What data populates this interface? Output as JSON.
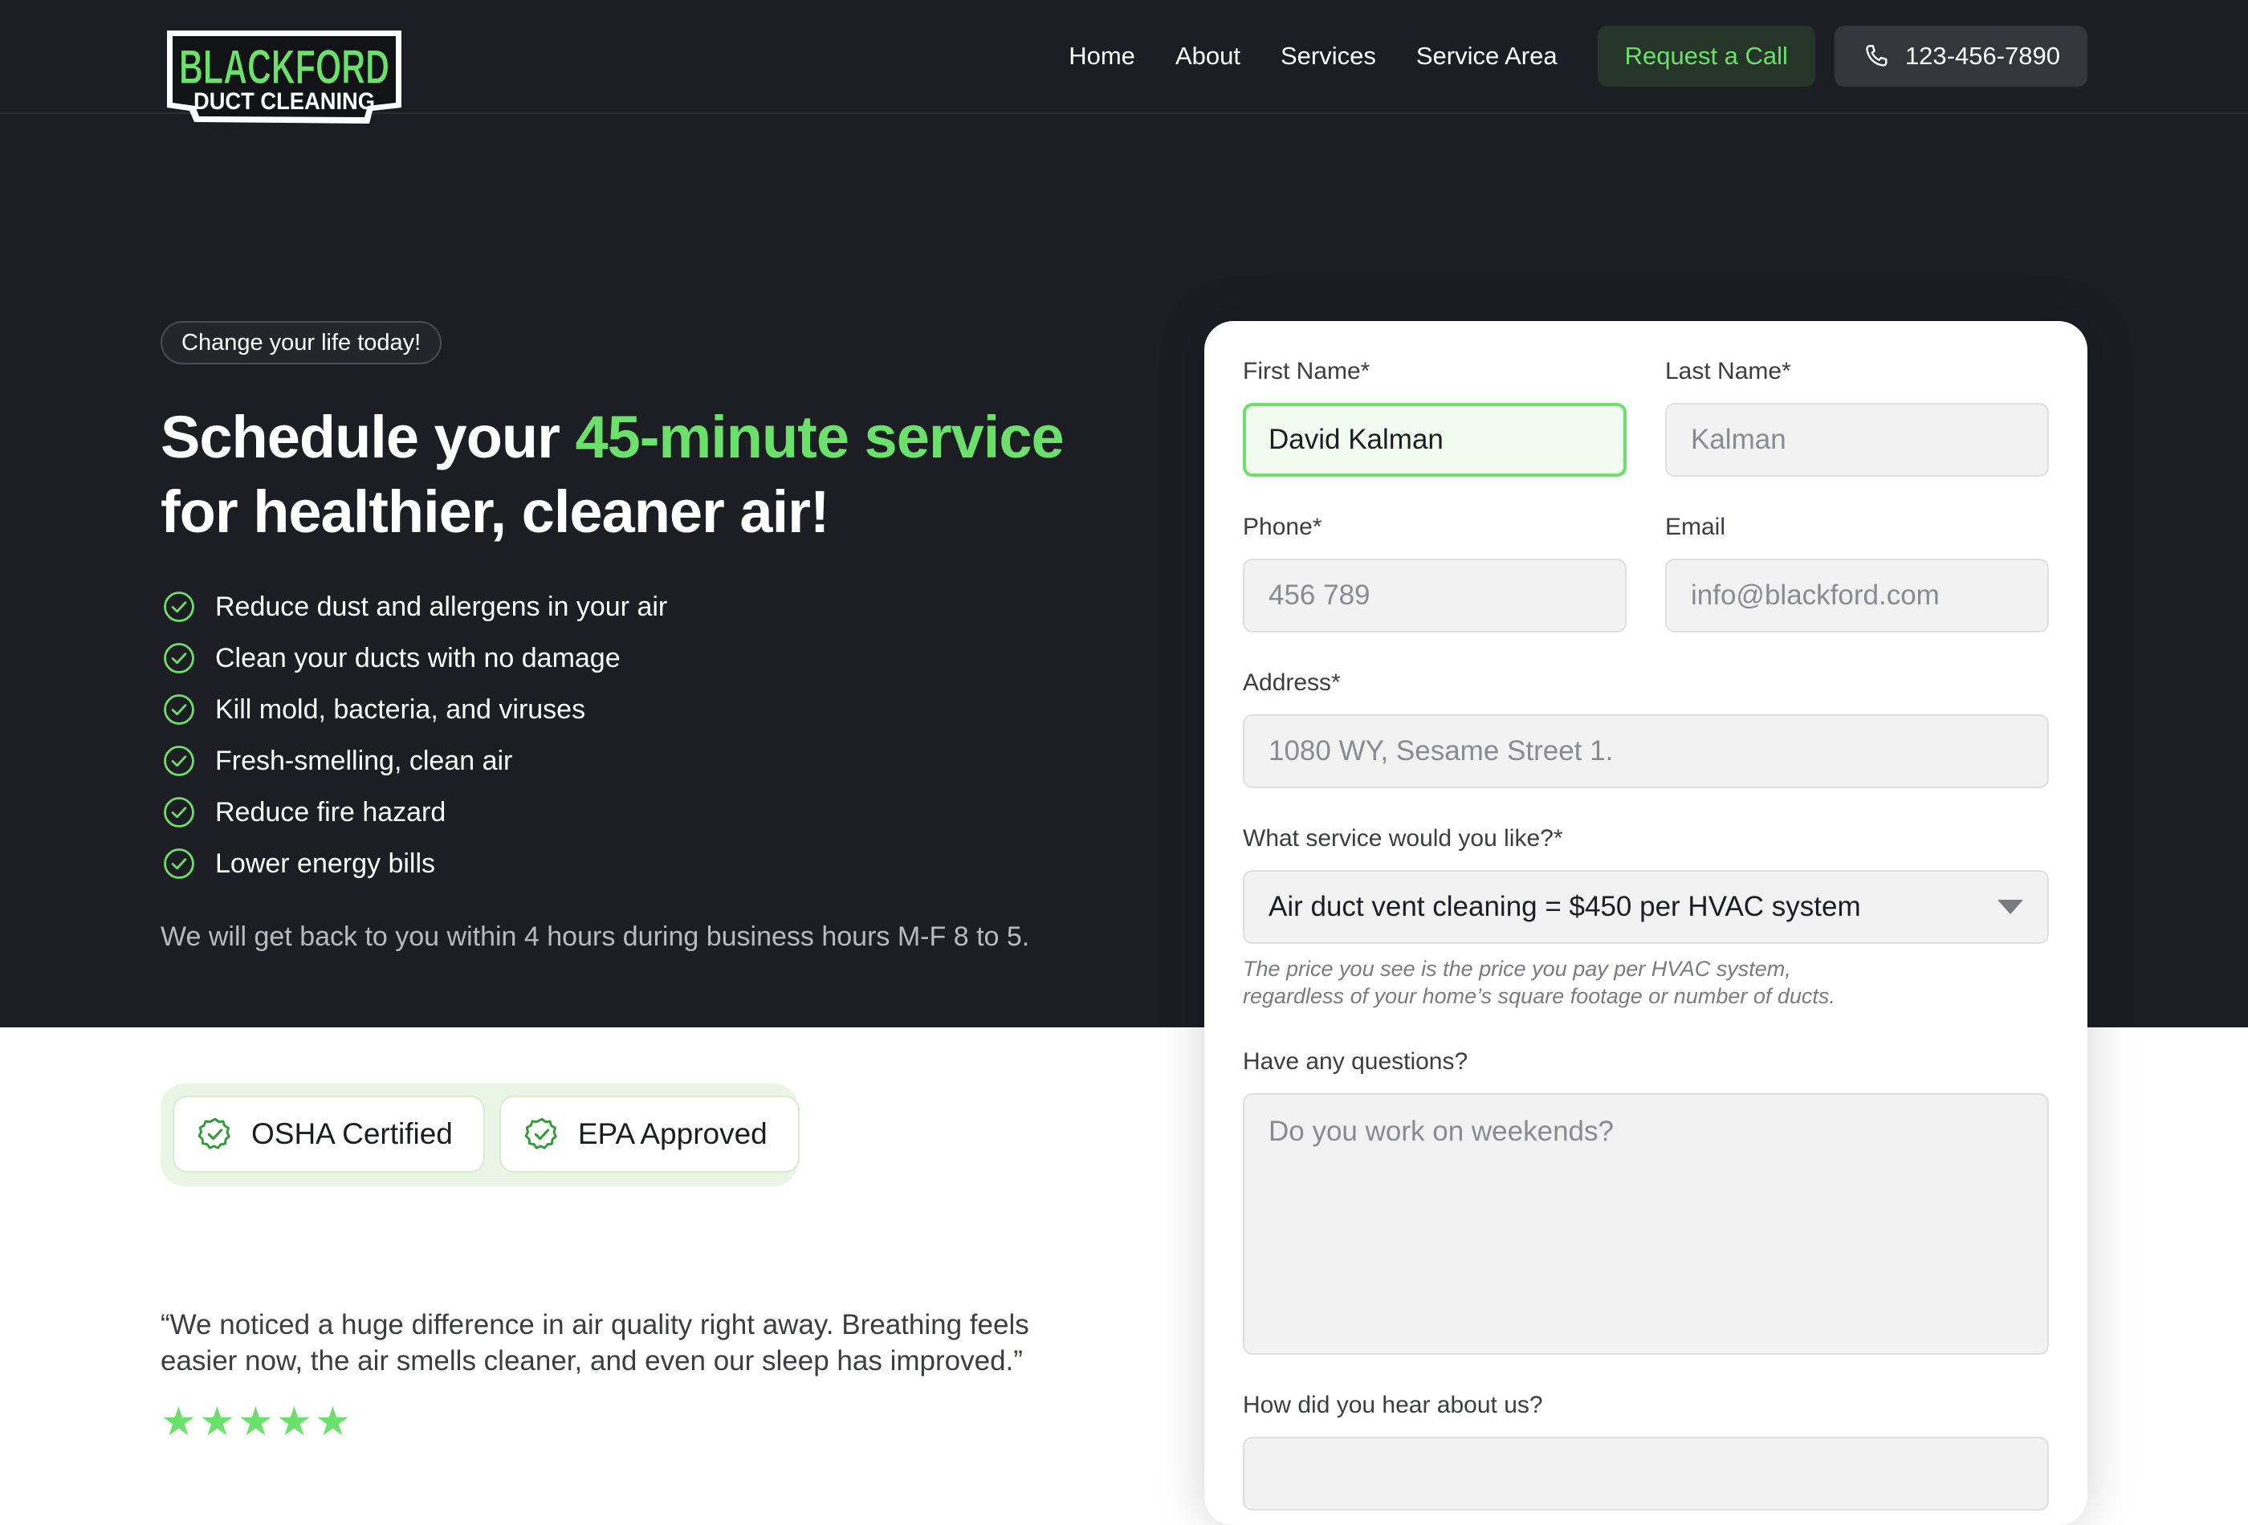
{
  "header": {
    "logo": {
      "line1": "BLACKFORD",
      "line2": "DUCT CLEANING"
    },
    "nav": [
      "Home",
      "About",
      "Services",
      "Service Area"
    ],
    "cta_label": "Request a Call",
    "phone": "123-456-7890"
  },
  "hero": {
    "pill": "Change your life today!",
    "headline_start": "Schedule your ",
    "headline_highlight": "45-minute service",
    "headline_end": "for healthier, cleaner air!",
    "benefits": [
      "Reduce dust and allergens in your air",
      "Clean your ducts with no damage",
      "Kill mold, bacteria, and viruses",
      "Fresh-smelling, clean air",
      "Reduce fire hazard",
      "Lower energy bills"
    ],
    "response_note": "We will get back to you within 4 hours during business hours M-F 8 to 5."
  },
  "badges": [
    "OSHA Certified",
    "EPA Approved"
  ],
  "testimonial": {
    "quote": "“We noticed a huge difference in air quality right away. Breathing feels easier now, the air smells cleaner, and even our sleep has improved.”",
    "rating": 5
  },
  "form": {
    "first_name": {
      "label": "First Name*",
      "value": "David Kalman"
    },
    "last_name": {
      "label": "Last Name*",
      "placeholder": "Kalman"
    },
    "phone": {
      "label": "Phone*",
      "placeholder": "456 789"
    },
    "email": {
      "label": "Email",
      "placeholder": "info@blackford.com"
    },
    "address": {
      "label": "Address*",
      "placeholder": "1080 WY, Sesame Street 1."
    },
    "service": {
      "label": "What service would you like?*",
      "selected": "Air duct vent cleaning = $450  per HVAC system",
      "note_line1": "The price you see is the price you pay per HVAC system,",
      "note_line2": "regardless of your home’s square footage or number of ducts."
    },
    "questions": {
      "label": "Have any questions?",
      "placeholder": "Do you work on weekends?"
    },
    "referral": {
      "label": "How did you hear about us?"
    }
  },
  "colors": {
    "accent": "#6be06a",
    "dark_bg": "#1d1e24"
  }
}
